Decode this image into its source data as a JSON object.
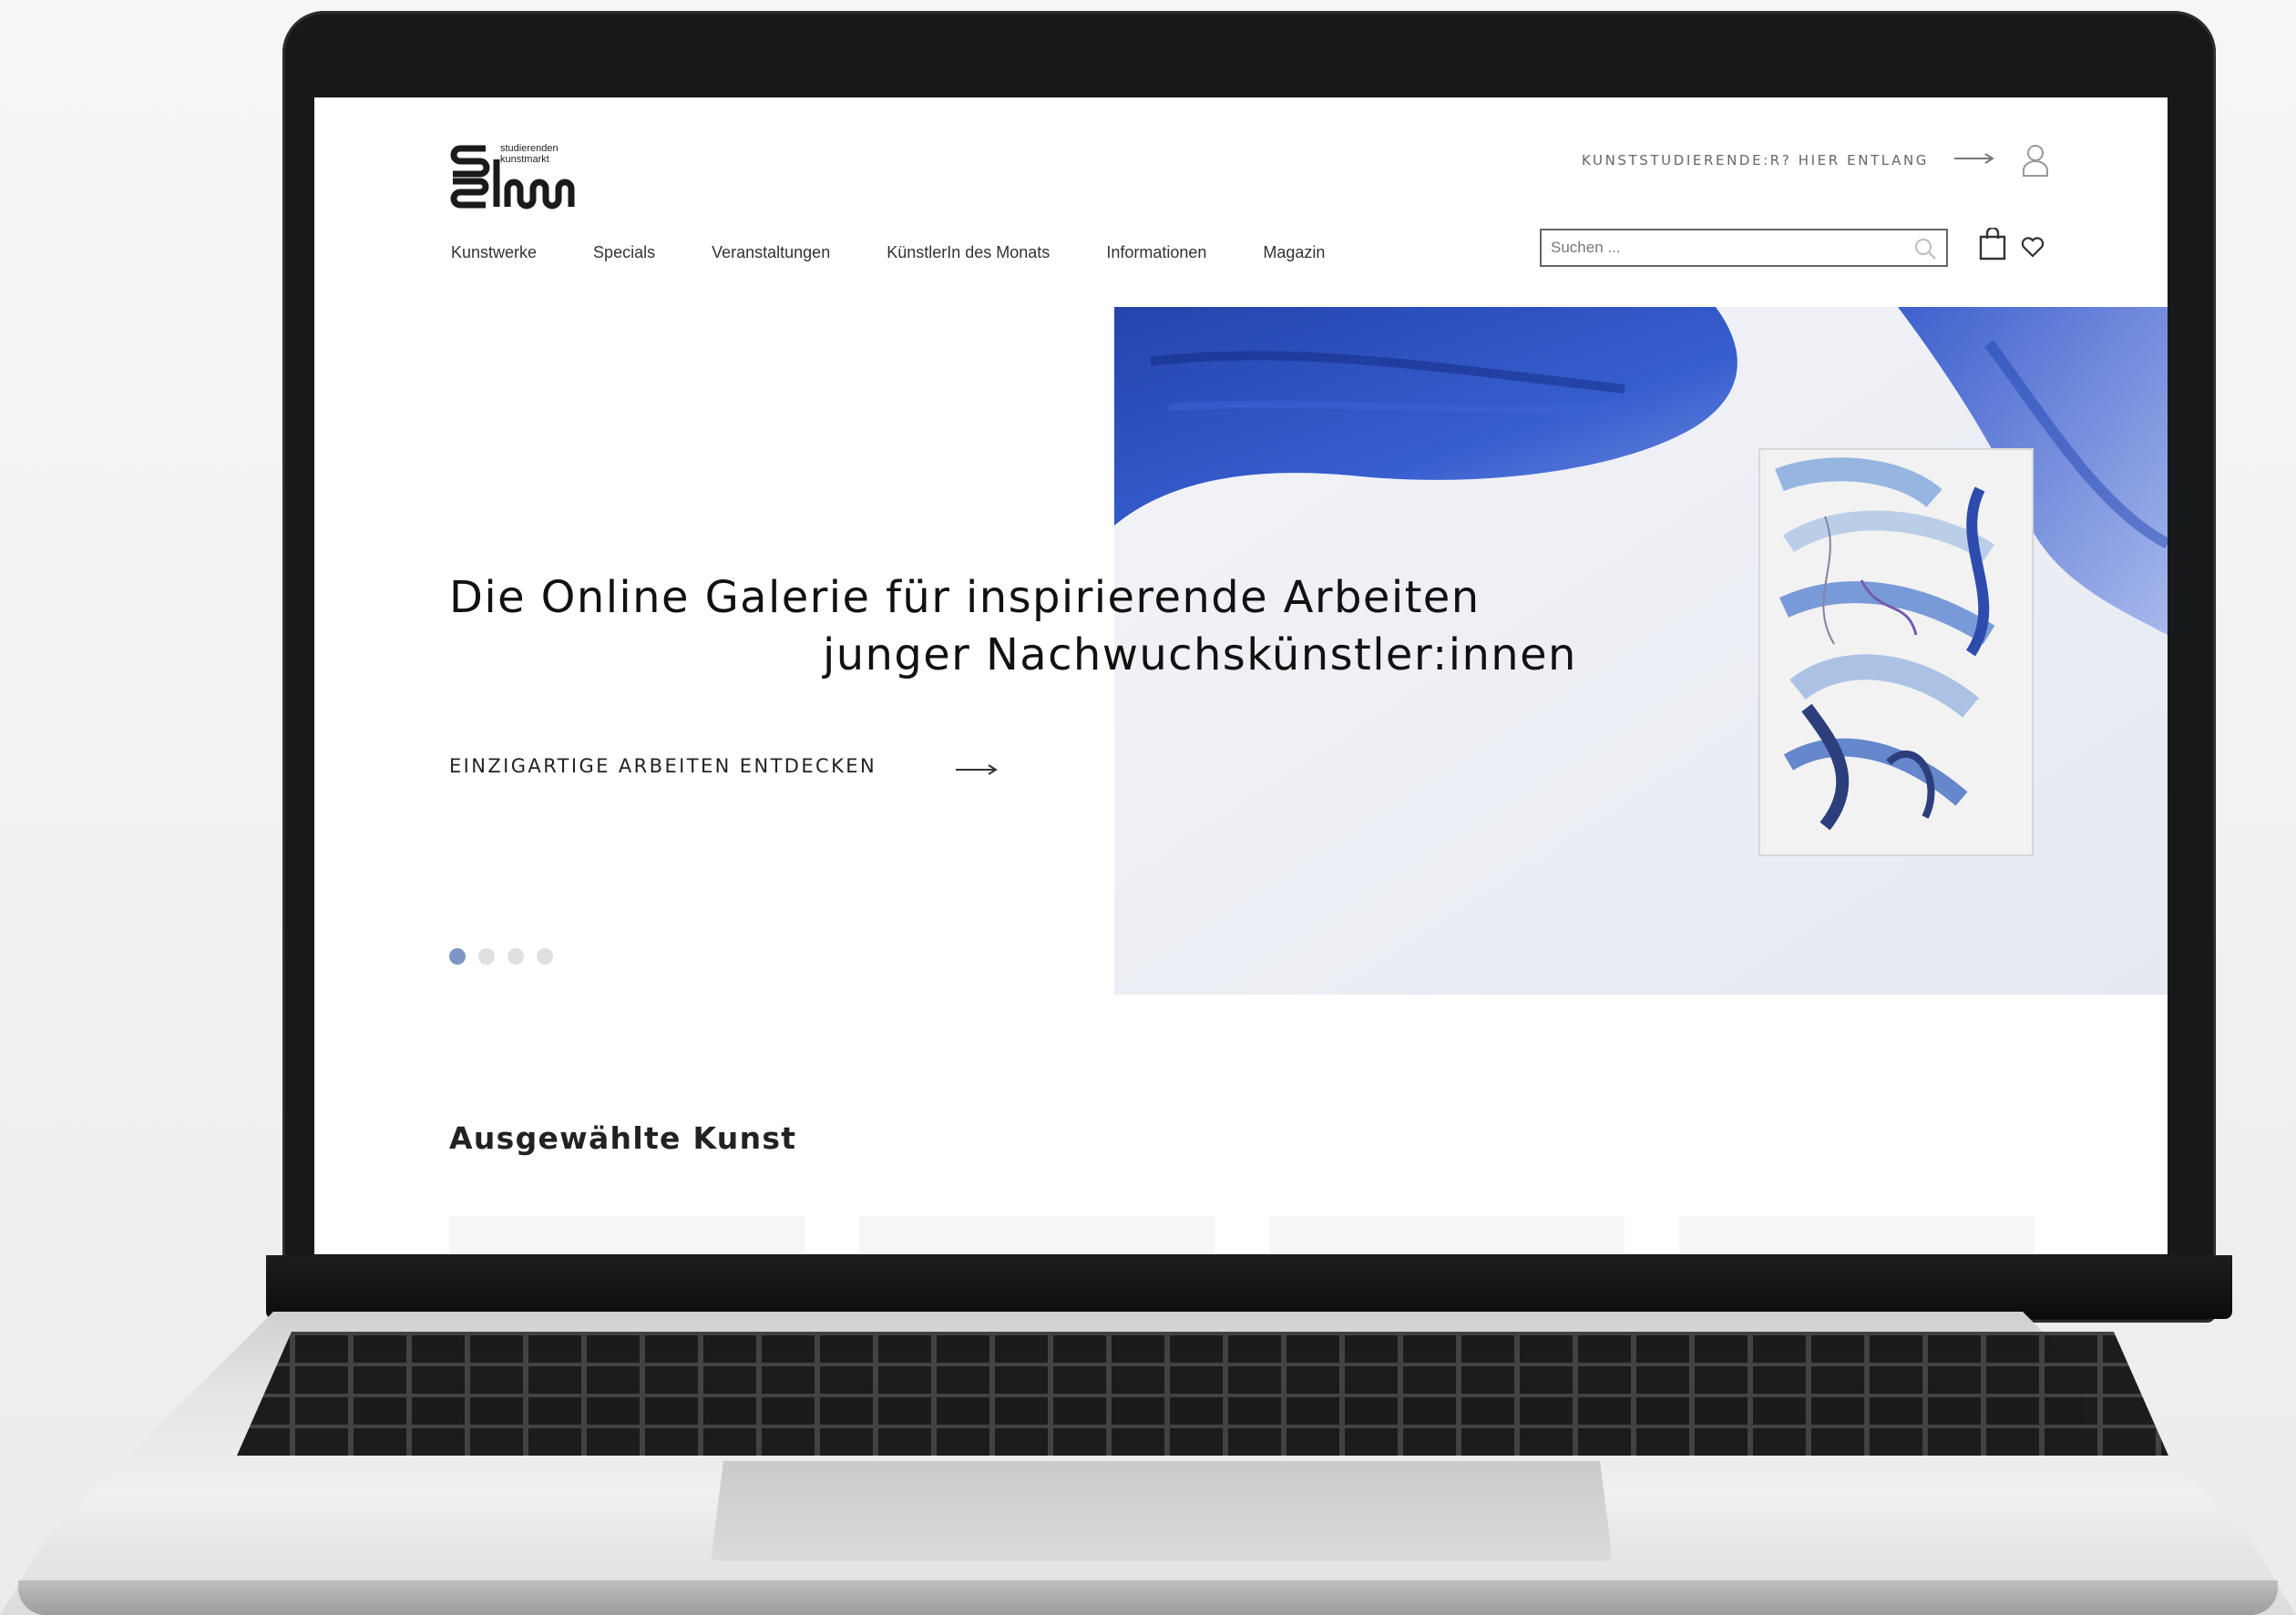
{
  "logo": {
    "line1": "studierenden",
    "line2": "kunstmarkt"
  },
  "topbar": {
    "cta_label": "KUNSTSTUDIERENDE:R? HIER ENTLANG"
  },
  "nav": {
    "items": [
      {
        "label": "Kunstwerke"
      },
      {
        "label": "Specials"
      },
      {
        "label": "Veranstaltungen"
      },
      {
        "label": "KünstlerIn des Monats"
      },
      {
        "label": "Informationen"
      },
      {
        "label": "Magazin"
      }
    ]
  },
  "search": {
    "placeholder": "Suchen ..."
  },
  "hero": {
    "title_line1": "Die Online Galerie für inspirierende Arbeiten",
    "title_line2": "junger Nachwuchskünstler:innen",
    "cta_label": "EINZIGARTIGE ARBEITEN ENTDECKEN",
    "slides_total": 4,
    "active_slide": 1,
    "accent_color": "#2d4fb8",
    "dot_active_color": "#7f95c6"
  },
  "featured": {
    "title": "Ausgewählte Kunst",
    "card_count": 4
  },
  "icons": [
    "logo-mark",
    "arrow-right-icon",
    "user-icon",
    "search-icon",
    "shopping-bag-icon",
    "heart-icon"
  ]
}
